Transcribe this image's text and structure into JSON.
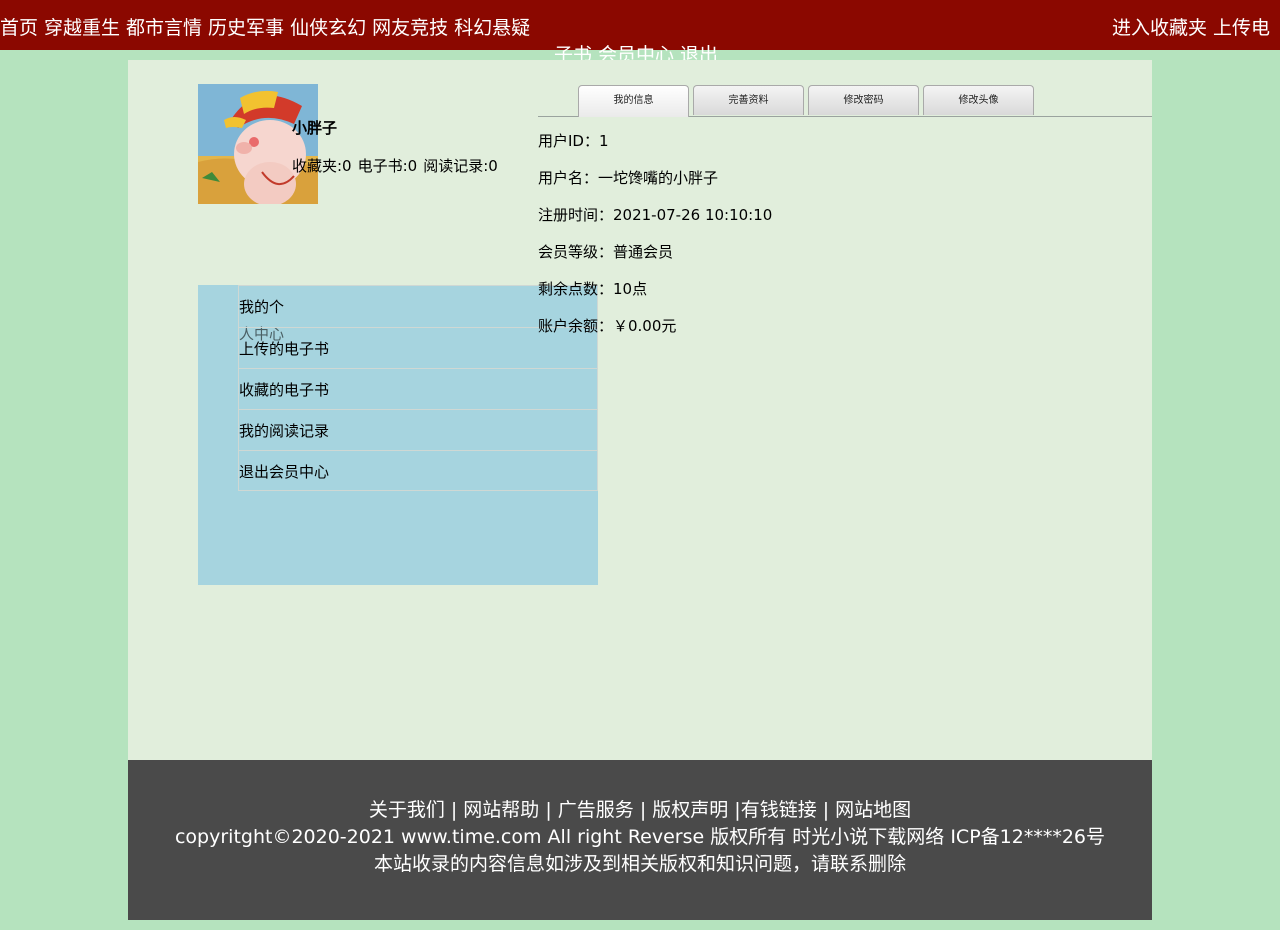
{
  "nav": {
    "left_links": [
      "首页",
      "穿越重生",
      "都市言情",
      "历史军事",
      "仙侠玄幻",
      "网友竞技",
      "科幻悬疑"
    ],
    "right_links": [
      "进入收藏夹",
      "上传电"
    ],
    "wrapped_links": [
      "子书",
      "会员中心",
      "退出"
    ]
  },
  "profile": {
    "username": "小胖子",
    "favorites_label": "收藏夹:0",
    "ebooks_label": "电子书:0",
    "reading_label": "阅读记录:0"
  },
  "menu": {
    "first_a": "我的个",
    "first_b": "人中心",
    "items": [
      "上传的电子书",
      "收藏的电子书",
      "我的阅读记录",
      "退出会员中心"
    ]
  },
  "tabs": [
    "我的信息",
    "完善资料",
    "修改密码",
    "修改头像"
  ],
  "info": [
    "用户ID：1",
    "用户名：一坨馋嘴的小胖子",
    "注册时间：2021-07-26 10:10:10",
    "会员等级：普通会员",
    "剩余点数：10点",
    "账户余额：￥0.00元"
  ],
  "footer": {
    "links_line": "关于我们 | 网站帮助 | 广告服务 | 版权声明 |有钱链接 | 网站地图",
    "copyright": "copyritght©2020-2021 www.time.com All right Reverse 版权所有 时光小说下载网络 ICP备12****26号",
    "notice": "本站收录的内容信息如涉及到相关版权和知识问题，请联系删除"
  },
  "colors": {
    "page_bg": "#b5e3be",
    "topbar": "#8b0800",
    "panel": "#e1eedc",
    "menu_bg": "#a6d4df",
    "footer": "#4a4a4a"
  }
}
